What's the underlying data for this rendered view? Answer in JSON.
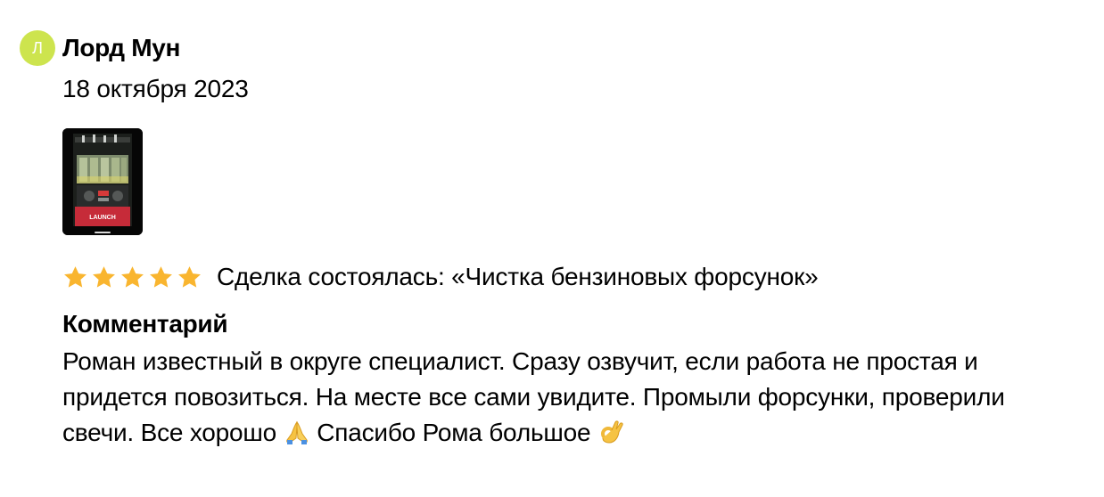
{
  "review": {
    "author": {
      "initial": "Л",
      "name": "Лорд Мун",
      "avatar_color": "#cde44e"
    },
    "date": "18 октября 2023",
    "photo": {
      "label": "LAUNCH"
    },
    "rating": 5,
    "star_color": "#f9b52f",
    "deal_text": "Сделка состоялась: «Чистка бензиновых форсунок»",
    "comment_heading": "Комментарий",
    "comment_text_part1": "Роман известный в округе специалист. Сразу озвучит, если работа не простая и придется повозиться. На месте все сами увидите. Промыли форсунки, проверили свечи. Все хорошо ",
    "comment_text_part2": " Спасибо Рома большое ",
    "emojis": [
      "folded-hands-emoji",
      "ok-hand-emoji"
    ]
  }
}
